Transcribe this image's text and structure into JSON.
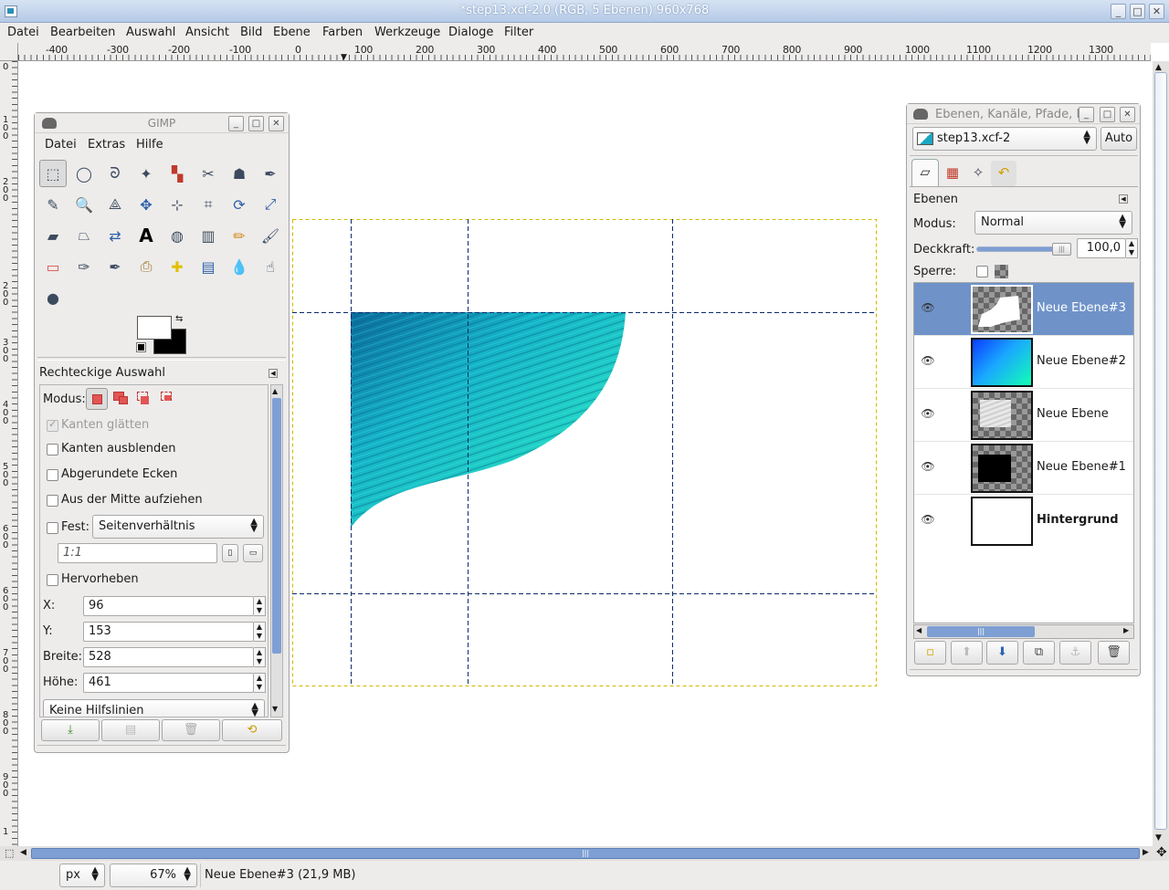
{
  "window": {
    "title": "*step13.xcf-2.0 (RGB, 5 Ebenen) 960x768",
    "minimize": "_",
    "maximize": "□",
    "close": "✕"
  },
  "menu": [
    "Datei",
    "Bearbeiten",
    "Auswahl",
    "Ansicht",
    "Bild",
    "Ebene",
    "Farben",
    "Werkzeuge",
    "Dialoge",
    "Filter"
  ],
  "ruler": {
    "h_labels": [
      "-400",
      "-300",
      "-200",
      "-100",
      "0",
      "100",
      "200",
      "300",
      "400",
      "500",
      "600",
      "700",
      "800",
      "900",
      "1000",
      "1100",
      "1200",
      "1300"
    ],
    "v_labels": [
      "0",
      "1\n0\n0",
      "2\n0\n0",
      "3\n0\n0",
      "4\n0\n0",
      "5\n0\n0",
      "6\n0\n0",
      "7\n0\n0",
      "8\n0\n0",
      "9\n0\n0",
      "1"
    ]
  },
  "toolbox": {
    "title": "GIMP",
    "menu": [
      "Datei",
      "Extras",
      "Hilfe"
    ],
    "tools": [
      "rect-select",
      "ellipse-select",
      "free-select",
      "fuzzy-select",
      "color-select",
      "scissors",
      "foreground-select",
      "paths",
      "color-picker",
      "zoom",
      "measure",
      "move",
      "align",
      "crop",
      "rotate",
      "scale",
      "shear",
      "perspective",
      "flip",
      "text",
      "bucket-fill",
      "blend",
      "pencil",
      "paintbrush",
      "eraser",
      "airbrush",
      "ink",
      "clone",
      "heal",
      "perspective-clone",
      "blur",
      "smudge",
      "dodge-burn"
    ],
    "options": {
      "title": "Rechteckige Auswahl",
      "mode_label": "Modus:",
      "antialias": "Kanten glätten",
      "feather": "Kanten ausblenden",
      "rounded": "Abgerundete Ecken",
      "from_center": "Aus der Mitte aufziehen",
      "fixed_label": "Fest:",
      "fixed_value": "Seitenverhältnis",
      "ratio": "1:1",
      "highlight": "Hervorheben",
      "x_label": "X:",
      "x_value": "96",
      "y_label": "Y:",
      "y_value": "153",
      "w_label": "Breite:",
      "w_value": "528",
      "h_label": "Höhe:",
      "h_value": "461",
      "guides": "Keine Hilfslinien"
    }
  },
  "layers_dock": {
    "title": "Ebenen, Kanäle, Pfade, R",
    "image": "step13.xcf-2",
    "auto": "Auto",
    "section": "Ebenen",
    "mode_label": "Modus:",
    "mode_value": "Normal",
    "opacity_label": "Deckkraft:",
    "opacity_value": "100,0",
    "opacity": 1.0,
    "lock_label": "Sperre:",
    "layers": [
      {
        "name": "Neue Ebene#3",
        "selected": true
      },
      {
        "name": "Neue Ebene#2",
        "selected": false
      },
      {
        "name": "Neue Ebene",
        "selected": false
      },
      {
        "name": "Neue Ebene#1",
        "selected": false
      },
      {
        "name": "Hintergrund",
        "selected": false
      }
    ]
  },
  "status": {
    "unit": "px",
    "zoom": "67%",
    "info": "Neue Ebene#3 (21,9 MB)"
  },
  "colors": {
    "accent": "#6f93c9",
    "selection": "#7e9fd4",
    "guide": "#0b2a6b"
  }
}
